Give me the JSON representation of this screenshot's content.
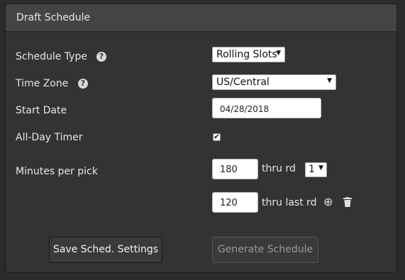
{
  "panel": {
    "title": "Draft Schedule"
  },
  "form": {
    "schedule_type": {
      "label": "Schedule Type",
      "help_icon": "?",
      "value": "Rolling Slots"
    },
    "time_zone": {
      "label": "Time Zone",
      "help_icon": "?",
      "value": "US/Central"
    },
    "start_date": {
      "label": "Start Date",
      "value": "04/28/2018"
    },
    "all_day_timer": {
      "label": "All-Day Timer",
      "checked": true,
      "check_glyph": "✔"
    },
    "minutes_per_pick": {
      "label": "Minutes per pick",
      "row1": {
        "value": "180",
        "suffix": "thru rd",
        "round_value": "1"
      },
      "row2": {
        "value": "120",
        "suffix": "thru last rd"
      }
    }
  },
  "buttons": {
    "save": "Save Sched. Settings",
    "generate": "Generate Schedule"
  },
  "icons": {
    "dropdown_arrow": "▼",
    "add": "⊕",
    "delete": "🗑"
  }
}
